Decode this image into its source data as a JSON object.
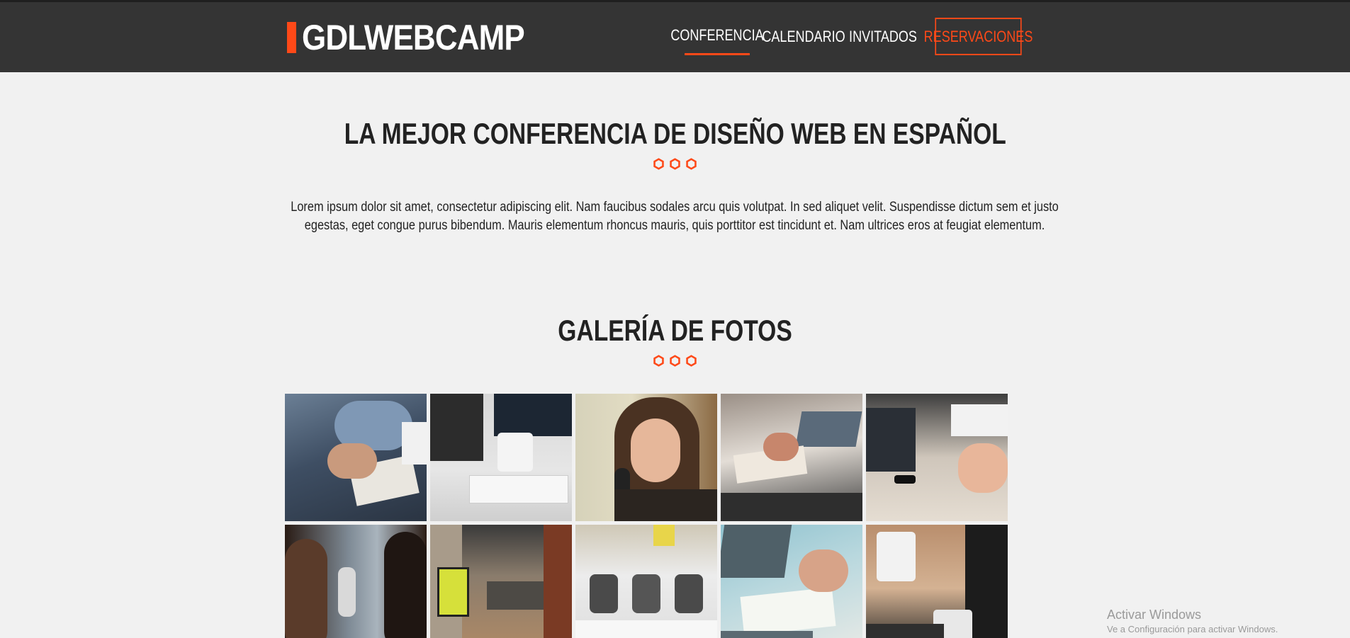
{
  "brand": {
    "name": "GDLWEBCAMP",
    "accent": "#fe4918",
    "header_bg": "#343434"
  },
  "nav": {
    "items": [
      {
        "label": "Conferencia",
        "active": true
      },
      {
        "label": "Calendario",
        "active": false
      },
      {
        "label": "Invitados",
        "active": false
      },
      {
        "label": "Reservaciones",
        "active": false
      }
    ]
  },
  "intro": {
    "title": "LA MEJOR CONFERENCIA DE DISEÑO WEB EN ESPAÑOL",
    "text": "Lorem ipsum dolor sit amet, consectetur adipiscing elit. Nam faucibus sodales arcu quis volutpat. In sed aliquet velit. Suspendisse dictum sem et justo egestas, eget congue purus bibendum. Mauris elementum rhoncus mauris, quis porttitor est tincidunt et. Nam ultrices eros at feugiat elementum."
  },
  "gallery": {
    "title": "GALERÍA DE FOTOS",
    "photos": [
      {
        "name": "person-writing-notes-photo"
      },
      {
        "name": "desk-computer-mug-photo"
      },
      {
        "name": "woman-speaker-microphone-photo"
      },
      {
        "name": "team-desk-laptops-photo"
      },
      {
        "name": "laptops-meeting-table-photo"
      },
      {
        "name": "conference-audience-speaker-photo"
      },
      {
        "name": "coworking-hallway-photo"
      },
      {
        "name": "office-chairs-room-photo"
      },
      {
        "name": "laptop-notes-writing-photo"
      },
      {
        "name": "coffee-cup-phone-laptop-photo"
      }
    ]
  },
  "watermark": {
    "title": "Activar Windows",
    "subtitle": "Ve a Configuración para activar Windows."
  }
}
